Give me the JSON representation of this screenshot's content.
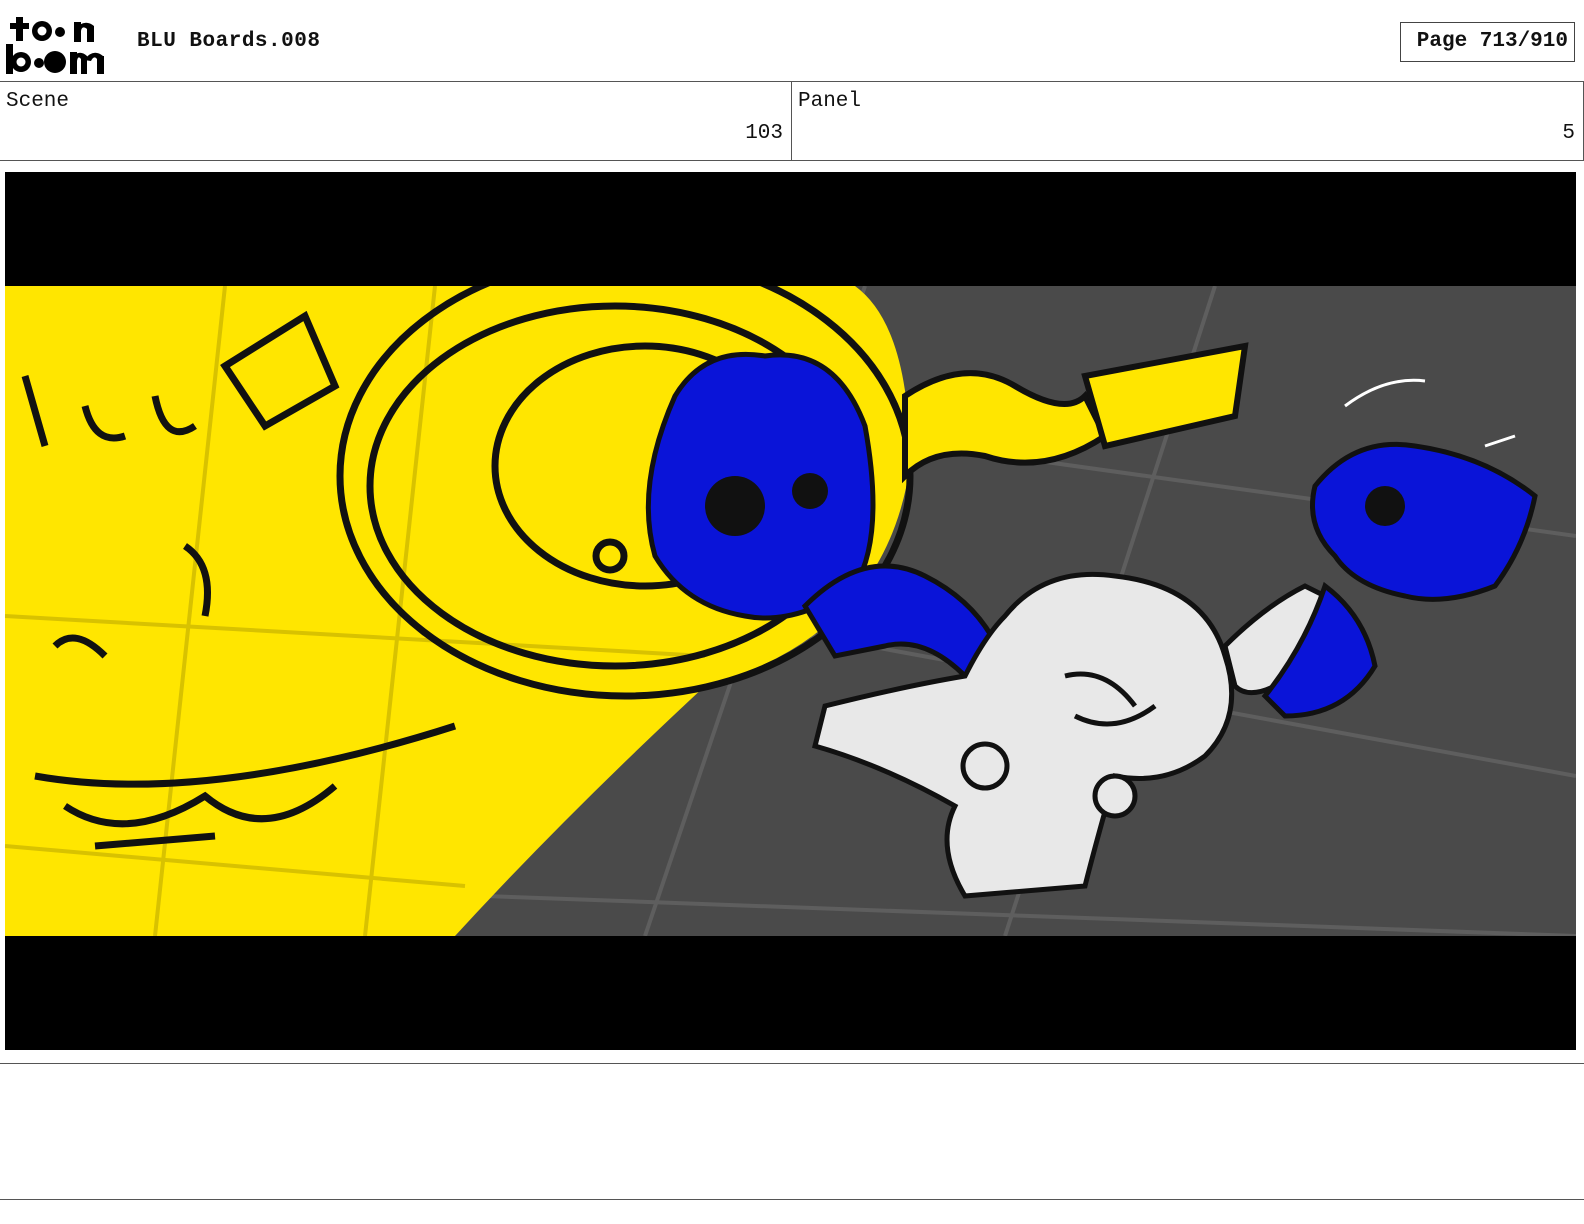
{
  "header": {
    "logo_text": "toonboom",
    "doc_title": "BLU Boards.008",
    "page_label": "Page 713/910"
  },
  "scene": {
    "label": "Scene",
    "value": "103"
  },
  "panel": {
    "label": "Panel",
    "value": "5"
  },
  "notes": {
    "text": ""
  },
  "colors": {
    "yellow": "#ffe600",
    "blue": "#0a14d8",
    "floor": "#4a4a4a",
    "letterbox": "#000000"
  }
}
